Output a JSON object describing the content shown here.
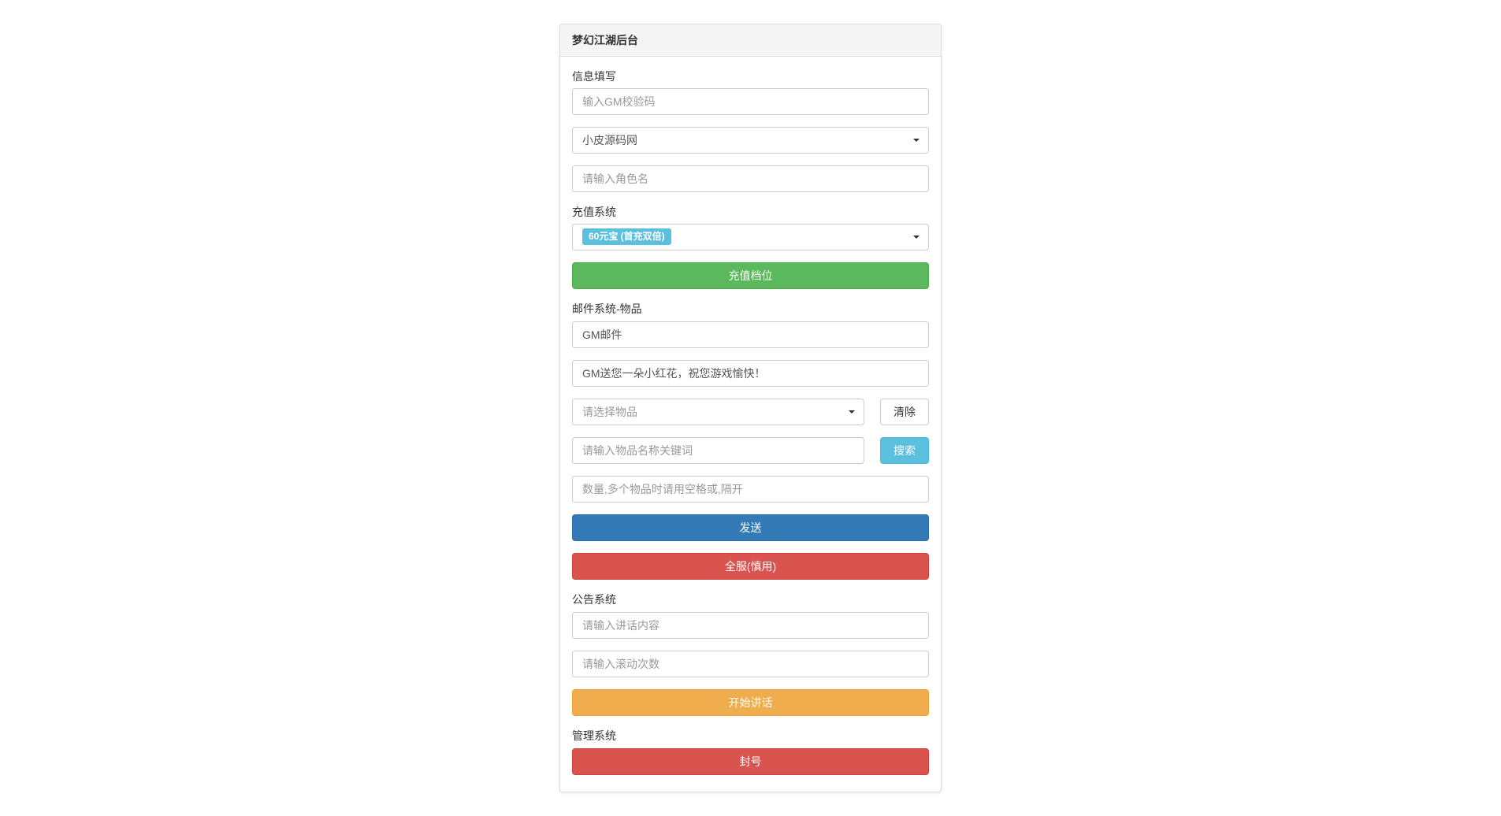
{
  "header": {
    "title": "梦幻江湖后台"
  },
  "info_section": {
    "label": "信息填写",
    "gm_code_placeholder": "输入GM校验码",
    "server_selected": "小皮源码网",
    "character_placeholder": "请输入角色名"
  },
  "recharge_section": {
    "label": "充值系统",
    "tier_selected": "60元宝 (首充双倍)",
    "button_label": "充值档位"
  },
  "mail_section": {
    "label": "邮件系统-物品",
    "subject_value": "GM邮件",
    "body_value": "GM送您一朵小红花，祝您游戏愉快！",
    "item_select_placeholder": "请选择物品",
    "clear_label": "清除",
    "item_search_placeholder": "请输入物品名称关键词",
    "search_label": "搜索",
    "quantity_placeholder": "数量,多个物品时请用空格或,隔开",
    "send_label": "发送",
    "broadcast_label": "全服(慎用)"
  },
  "announce_section": {
    "label": "公告系统",
    "content_placeholder": "请输入讲话内容",
    "scroll_placeholder": "请输入滚动次数",
    "start_label": "开始讲话"
  },
  "admin_section": {
    "label": "管理系统",
    "ban_label": "封号"
  }
}
